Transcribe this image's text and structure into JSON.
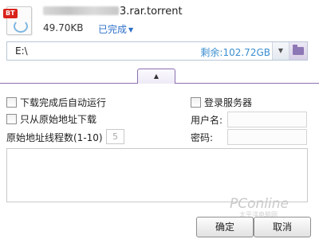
{
  "file": {
    "icon_badge": "BT",
    "name_suffix": "3.rar.torrent",
    "size": "49.70KB",
    "status": "已完成"
  },
  "save_path": {
    "value": "E:\\",
    "free_space": "剩余:102.72GB"
  },
  "options": {
    "auto_run": "下载完成后自动运行",
    "origin_only": "只从原始地址下载",
    "thread_label": "原始地址线程数(1-10)",
    "thread_value": "5",
    "login_server": "登录服务器",
    "username_label": "用户名:",
    "password_label": "密码:"
  },
  "buttons": {
    "ok": "确定",
    "cancel": "取消"
  },
  "watermark": {
    "brand": "PConline",
    "sub": "太平洋电脑网"
  },
  "colors": {
    "accent_link": "#2c6fc9",
    "free_space": "#3a8ed0",
    "divider": "#8a6fb2",
    "badge": "#d9231b"
  },
  "icons": [
    "bt-file-icon",
    "chevron-down-icon",
    "folder-icon",
    "chevron-up-icon"
  ]
}
